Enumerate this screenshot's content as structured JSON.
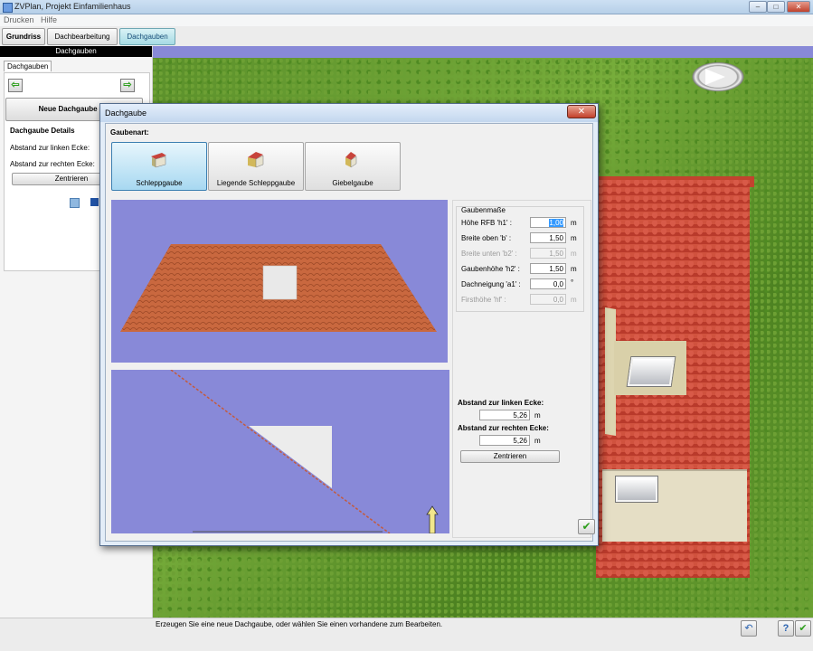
{
  "window": {
    "title": "ZVPlan, Projekt Einfamilienhaus",
    "controls": {
      "minimize": "–",
      "maximize": "□",
      "close": "✕"
    }
  },
  "menu": {
    "items": [
      "Drucken",
      "Hilfe"
    ]
  },
  "tabs": {
    "items": [
      {
        "label": "Grundriss"
      },
      {
        "label": "Dachbearbeitung"
      },
      {
        "label": "Dachgauben",
        "active": true
      }
    ]
  },
  "left_panel": {
    "header": "Dachgauben",
    "tab": "Dachgauben",
    "prev_icon": "arrow-left-icon",
    "next_icon": "arrow-right-icon",
    "new_button": "Neue Dachgaube anl",
    "details_heading": "Dachgaube Details",
    "left_distance_label": "Abstand zur linken Ecke:",
    "right_distance_label": "Abstand zur rechten Ecke:",
    "center_button": "Zentrieren"
  },
  "dialog": {
    "title": "Dachgaube",
    "close": "✕",
    "type_label": "Gaubenart:",
    "types": [
      {
        "label": "Schleppgaube",
        "active": true,
        "icon": "shed-dormer-icon"
      },
      {
        "label": "Liegende Schleppgaube",
        "active": false,
        "icon": "lying-shed-dormer-icon"
      },
      {
        "label": "Giebelgaube",
        "active": false,
        "icon": "gable-dormer-icon"
      }
    ],
    "dimensions": {
      "heading": "Gaubenmaße",
      "fields": [
        {
          "label": "Höhe RFB 'h1' :",
          "value": "1,00",
          "unit": "m",
          "enabled": true,
          "selected": true
        },
        {
          "label": "Breite oben 'b' :",
          "value": "1,50",
          "unit": "m",
          "enabled": true
        },
        {
          "label": "Breite unten 'b2' :",
          "value": "1,50",
          "unit": "m",
          "enabled": false
        },
        {
          "label": "Gaubenhöhe 'h2' :",
          "value": "1,50",
          "unit": "m",
          "enabled": true
        },
        {
          "label": "Dachneigung 'a1' :",
          "value": "0,0",
          "unit": "°",
          "enabled": true
        },
        {
          "label": "Firsthöhe 'hf' :",
          "value": "0,0",
          "unit": "m",
          "enabled": false
        }
      ]
    },
    "position": {
      "left_label": "Abstand zur linken Ecke:",
      "left_value": "5,26",
      "left_unit": "m",
      "right_label": "Abstand zur rechten Ecke:",
      "right_value": "5,26",
      "right_unit": "m",
      "center_button": "Zentrieren"
    },
    "ok_icon": "checkmark-icon"
  },
  "status": {
    "message": "Erzeugen Sie eine neue Dachgaube, oder wählen Sie einen vorhandene zum Bearbeiten.",
    "icons": [
      "undo-icon",
      "help-icon",
      "checkmark-icon"
    ]
  },
  "colors": {
    "viewport_bg": "#8889d8",
    "active_tab": "#a6dbe4",
    "grass": "#5a8f2a",
    "roof_tile": "#c2432f"
  }
}
